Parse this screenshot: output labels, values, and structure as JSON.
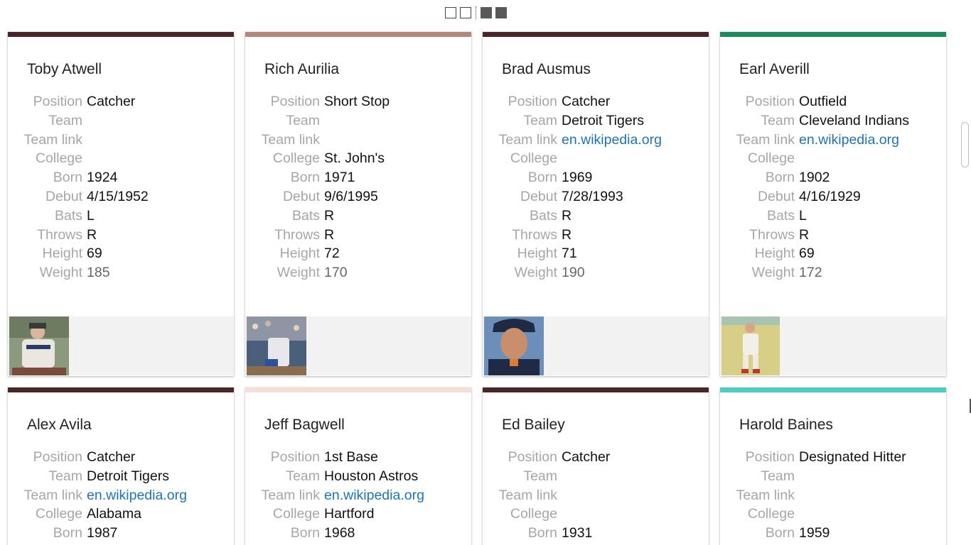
{
  "view_toggle": {
    "icons": [
      "single-view-icon",
      "double-view-icon",
      "grid-view-icon",
      "list-view-icon"
    ]
  },
  "cards": [
    {
      "name": "Toby Atwell",
      "accent": "#4a2626",
      "fields": [
        {
          "label": "Position",
          "value": "Catcher"
        },
        {
          "label": "Team",
          "value": ""
        },
        {
          "label": "Team link",
          "value": ""
        },
        {
          "label": "College",
          "value": ""
        },
        {
          "label": "Born",
          "value": "1924"
        },
        {
          "label": "Debut",
          "value": "4/15/1952"
        },
        {
          "label": "Bats",
          "value": "L"
        },
        {
          "label": "Throws",
          "value": "R"
        },
        {
          "label": "Height",
          "value": "69"
        },
        {
          "label": "Weight",
          "value": "185"
        }
      ],
      "photo": "player-photo-icon"
    },
    {
      "name": "Rich Aurilia",
      "accent": "#b58679",
      "fields": [
        {
          "label": "Position",
          "value": "Short Stop"
        },
        {
          "label": "Team",
          "value": ""
        },
        {
          "label": "Team link",
          "value": ""
        },
        {
          "label": "College",
          "value": "St. John's"
        },
        {
          "label": "Born",
          "value": "1971"
        },
        {
          "label": "Debut",
          "value": "9/6/1995"
        },
        {
          "label": "Bats",
          "value": "R"
        },
        {
          "label": "Throws",
          "value": "R"
        },
        {
          "label": "Height",
          "value": "72"
        },
        {
          "label": "Weight",
          "value": "170"
        }
      ],
      "photo": "player-photo-icon"
    },
    {
      "name": "Brad Ausmus",
      "accent": "#4a2626",
      "fields": [
        {
          "label": "Position",
          "value": "Catcher"
        },
        {
          "label": "Team",
          "value": "Detroit Tigers"
        },
        {
          "label": "Team link",
          "value": "en.wikipedia.org"
        },
        {
          "label": "College",
          "value": ""
        },
        {
          "label": "Born",
          "value": "1969"
        },
        {
          "label": "Debut",
          "value": "7/28/1993"
        },
        {
          "label": "Bats",
          "value": "R"
        },
        {
          "label": "Throws",
          "value": "R"
        },
        {
          "label": "Height",
          "value": "71"
        },
        {
          "label": "Weight",
          "value": "190"
        }
      ],
      "photo": "player-photo-icon"
    },
    {
      "name": "Earl Averill",
      "accent": "#1b8a5e",
      "fields": [
        {
          "label": "Position",
          "value": "Outfield"
        },
        {
          "label": "Team",
          "value": "Cleveland Indians"
        },
        {
          "label": "Team link",
          "value": "en.wikipedia.org"
        },
        {
          "label": "College",
          "value": ""
        },
        {
          "label": "Born",
          "value": "1902"
        },
        {
          "label": "Debut",
          "value": "4/16/1929"
        },
        {
          "label": "Bats",
          "value": "L"
        },
        {
          "label": "Throws",
          "value": "R"
        },
        {
          "label": "Height",
          "value": "69"
        },
        {
          "label": "Weight",
          "value": "172"
        }
      ],
      "photo": "player-photo-icon"
    },
    {
      "name": "Alex Avila",
      "accent": "#4a2626",
      "fields": [
        {
          "label": "Position",
          "value": "Catcher"
        },
        {
          "label": "Team",
          "value": "Detroit Tigers"
        },
        {
          "label": "Team link",
          "value": "en.wikipedia.org"
        },
        {
          "label": "College",
          "value": "Alabama"
        },
        {
          "label": "Born",
          "value": "1987"
        }
      ]
    },
    {
      "name": "Jeff Bagwell",
      "accent": "#f4ded8",
      "fields": [
        {
          "label": "Position",
          "value": "1st Base"
        },
        {
          "label": "Team",
          "value": "Houston Astros"
        },
        {
          "label": "Team link",
          "value": "en.wikipedia.org"
        },
        {
          "label": "College",
          "value": "Hartford"
        },
        {
          "label": "Born",
          "value": "1968"
        }
      ]
    },
    {
      "name": "Ed Bailey",
      "accent": "#4a2626",
      "fields": [
        {
          "label": "Position",
          "value": "Catcher"
        },
        {
          "label": "Team",
          "value": ""
        },
        {
          "label": "Team link",
          "value": ""
        },
        {
          "label": "College",
          "value": ""
        },
        {
          "label": "Born",
          "value": "1931"
        }
      ]
    },
    {
      "name": "Harold Baines",
      "accent": "#4ecdc4",
      "fields": [
        {
          "label": "Position",
          "value": "Designated Hitter"
        },
        {
          "label": "Team",
          "value": ""
        },
        {
          "label": "Team link",
          "value": ""
        },
        {
          "label": "College",
          "value": ""
        },
        {
          "label": "Born",
          "value": "1959"
        }
      ]
    }
  ]
}
